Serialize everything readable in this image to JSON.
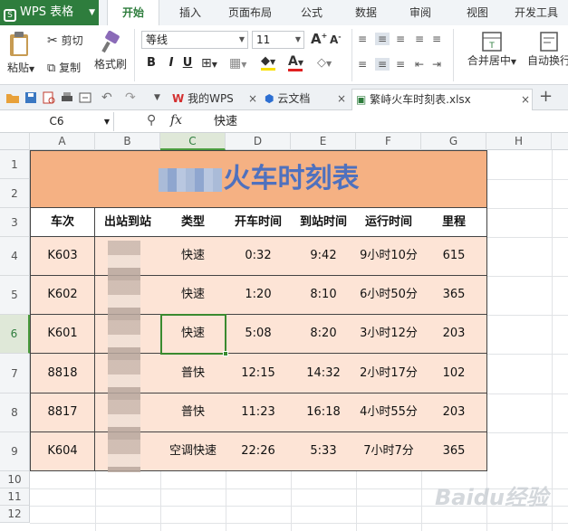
{
  "app": {
    "name": "WPS 表格"
  },
  "menu": [
    "开始",
    "插入",
    "页面布局",
    "公式",
    "数据",
    "审阅",
    "视图",
    "开发工具"
  ],
  "ribbon": {
    "paste": "粘贴",
    "cut": "剪切",
    "copy": "复制",
    "format_painter": "格式刷",
    "font_name": "等线",
    "font_size": "11",
    "bold": "B",
    "italic": "I",
    "underline": "U",
    "merge_center": "合并居中",
    "wrap": "自动换行"
  },
  "tabs": {
    "t1": "我的WPS",
    "t2": "云文档",
    "t3": "繁峙火车时刻表.xlsx"
  },
  "formula": {
    "cell_ref": "C6",
    "fx": "fx",
    "value": "快速"
  },
  "columns": [
    "A",
    "B",
    "C",
    "D",
    "E",
    "F",
    "G",
    "H"
  ],
  "rows": [
    "1",
    "2",
    "3",
    "4",
    "5",
    "6",
    "7",
    "8",
    "9",
    "10",
    "11",
    "12"
  ],
  "sheet": {
    "title": "火车时刻表",
    "headers": [
      "车次",
      "出站到站",
      "类型",
      "开车时间",
      "到站时间",
      "运行时间",
      "里程"
    ],
    "data": [
      [
        "K603",
        "",
        "快速",
        "0:32",
        "9:42",
        "9小时10分",
        "615"
      ],
      [
        "K602",
        "",
        "快速",
        "1:20",
        "8:10",
        "6小时50分",
        "365"
      ],
      [
        "K601",
        "",
        "快速",
        "5:08",
        "8:20",
        "3小时12分",
        "203"
      ],
      [
        "8818",
        "",
        "普快",
        "12:15",
        "14:32",
        "2小时17分",
        "102"
      ],
      [
        "8817",
        "",
        "普快",
        "11:23",
        "16:18",
        "4小时55分",
        "203"
      ],
      [
        "K604",
        "",
        "空调快速",
        "22:26",
        "5:33",
        "7小时7分",
        "365"
      ]
    ]
  },
  "colors": {
    "title_bg": "#f5b183",
    "data_bg": "#fde4d6",
    "title_text": "#4f71be",
    "accent": "#2e7d3d"
  },
  "watermark": "Baidu经验"
}
